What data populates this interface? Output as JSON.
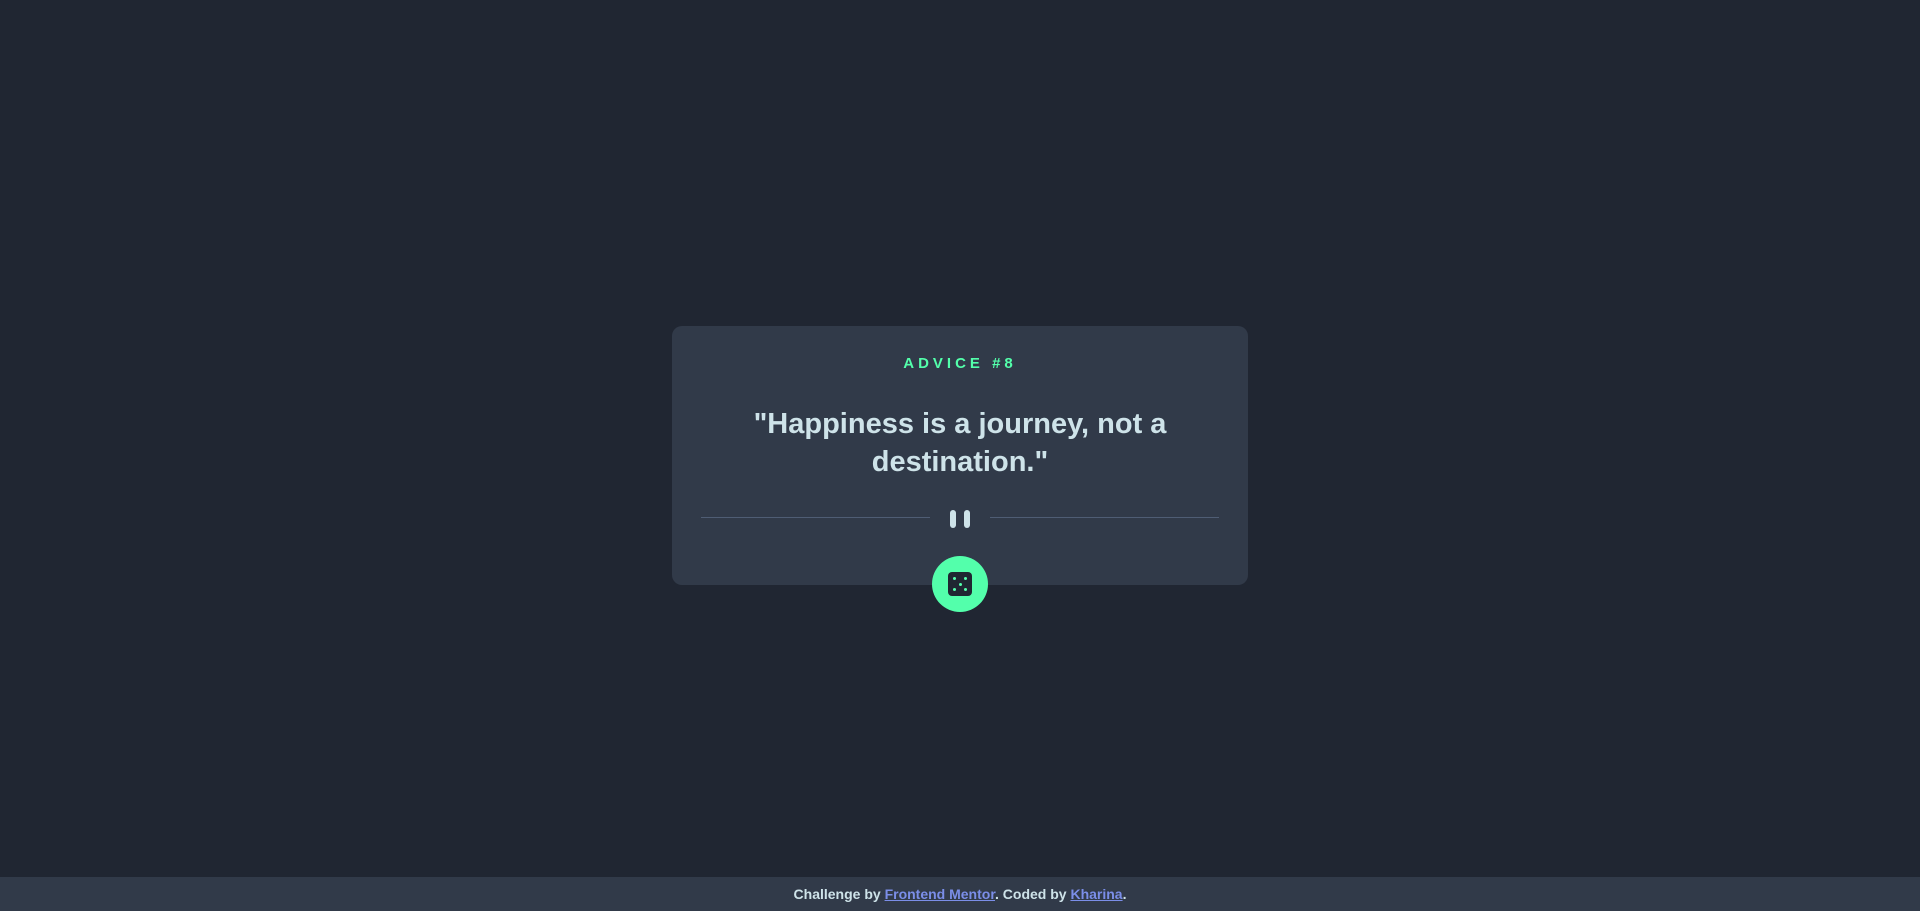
{
  "colors": {
    "background": "#202632",
    "card": "#313a49",
    "accent": "#53ffab",
    "text": "#cee3e9",
    "divider": "#4f5d74",
    "link": "#7b8ee8"
  },
  "card": {
    "advice_label": "ADVICE #8",
    "quote": "\"Happiness is a journey, not a destination.\"",
    "divider_icon": "pause-icon",
    "button_icon": "dice-icon"
  },
  "footer": {
    "prefix": "Challenge by ",
    "challenge_link": "Frontend Mentor",
    "middle": ". Coded by ",
    "author_link": "Kharina",
    "suffix": "."
  }
}
